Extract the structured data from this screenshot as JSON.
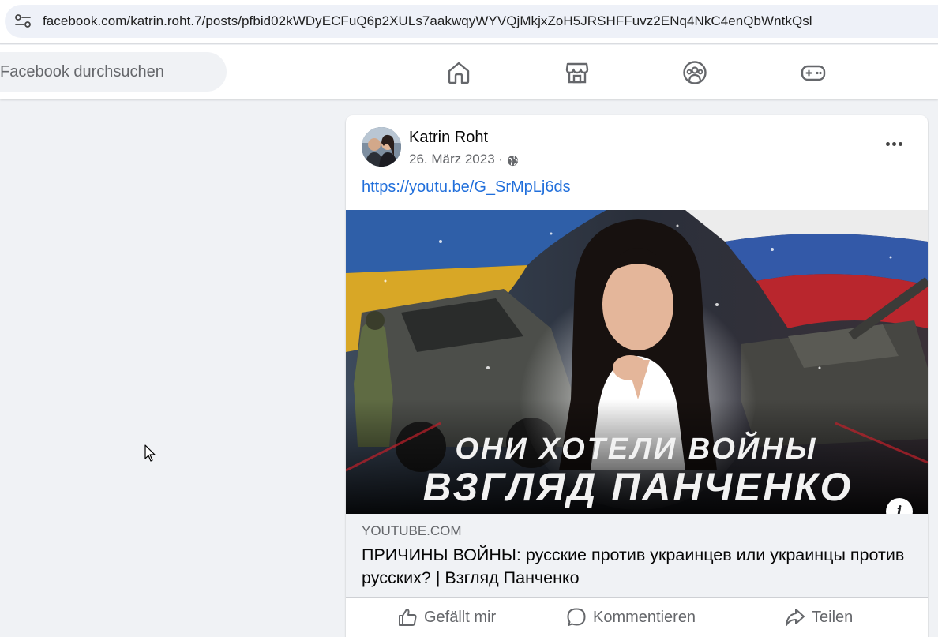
{
  "browser": {
    "url": "facebook.com/katrin.roht.7/posts/pfbid02kWDyECFuQ6p2XULs7aakwqyWYVQjMkjxZoH5JRSHFFuvz2ENq4NkC4enQbWntkQsl"
  },
  "header": {
    "search_placeholder": "Facebook durchsuchen",
    "nav": [
      {
        "icon": "home-icon"
      },
      {
        "icon": "marketplace-icon"
      },
      {
        "icon": "groups-icon"
      },
      {
        "icon": "gaming-icon"
      }
    ]
  },
  "post": {
    "author": "Katrin Roht",
    "date": "26. März 2023 ·",
    "link_text": "https://youtu.be/G_SrMpLj6ds",
    "thumbnail": {
      "line1": "ОНИ ХОТЕЛИ ВОЙНЫ",
      "line2": "ВЗГЛЯД ПАНЧЕНКО"
    },
    "preview": {
      "domain": "YOUTUBE.COM",
      "title": "ПРИЧИНЫ ВОЙНЫ: русские против украинцев или украинцы против русских? | Взгляд Панченко"
    },
    "actions": {
      "like": "Gefällt mir",
      "comment": "Kommentieren",
      "share": "Teilen"
    }
  },
  "colors": {
    "link": "#216fdb",
    "muted": "#65676b",
    "background": "#f0f2f5"
  }
}
